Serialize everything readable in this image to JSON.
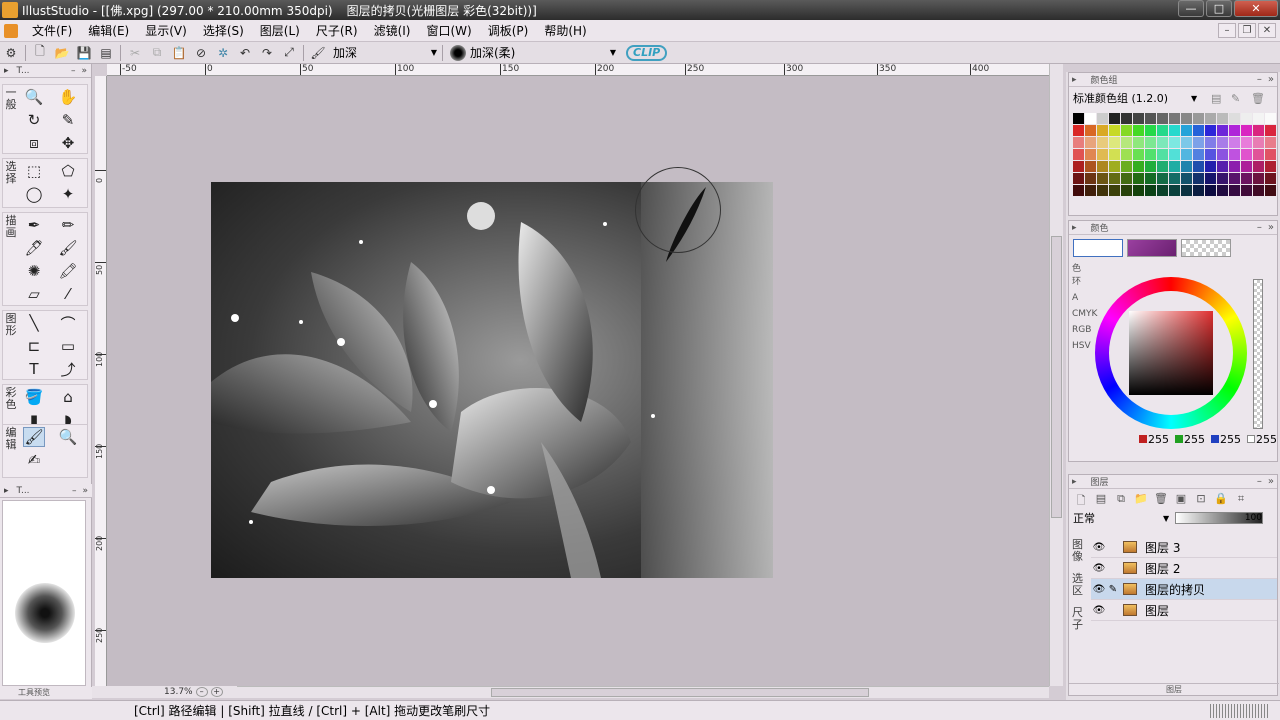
{
  "window": {
    "app_title": "IllustStudio - [[佛.xpg] (297.00 * 210.00mm 350dpi)",
    "doc_info": "图层的拷贝(光栅图层 彩色(32bit))]",
    "min_label": "—",
    "max_label": "□",
    "close_label": "✕"
  },
  "menu": {
    "items": [
      "文件(F)",
      "编辑(E)",
      "显示(V)",
      "选择(S)",
      "图层(L)",
      "尺子(R)",
      "滤镜(I)",
      "窗口(W)",
      "调板(P)",
      "帮助(H)"
    ]
  },
  "toolbar": {
    "blend_mode": "加深",
    "brush_name": "加深(柔)",
    "logo": "CLIP"
  },
  "tool_palette": {
    "title": "T...",
    "groups": [
      {
        "label": "一般"
      },
      {
        "label": "选择"
      },
      {
        "label": "描画"
      },
      {
        "label": "图形"
      },
      {
        "label": "彩色"
      },
      {
        "label": "编辑"
      }
    ],
    "brush_preview_title": "T...",
    "footer": "工具预览"
  },
  "ruler": {
    "top_labels": [
      "-50",
      "0",
      "50",
      "100",
      "150",
      "200",
      "250",
      "300",
      "350",
      "400"
    ],
    "left_labels": [
      "0",
      "50",
      "100",
      "150",
      "200",
      "250"
    ]
  },
  "canvas": {
    "zoom": "13.7%"
  },
  "swatch_panel": {
    "title": "颜色组",
    "set_name": "标准颜色组 (1.2.0)"
  },
  "color_panel": {
    "title": "颜色",
    "side_tabs": [
      "色环",
      "A",
      "CMYK",
      "RGB",
      "HSV"
    ],
    "r": "255",
    "g": "255",
    "b": "255",
    "a": "255"
  },
  "layer_panel": {
    "title": "图层",
    "blend_mode": "正常",
    "opacity": "100",
    "side_tabs": [
      "图像",
      "选区",
      "尺子"
    ],
    "layers": [
      {
        "name": "图层 3"
      },
      {
        "name": "图层 2"
      },
      {
        "name": "图层的拷贝"
      },
      {
        "name": "图层"
      }
    ],
    "footer": "图层"
  },
  "status": {
    "hint": "[Ctrl] 路径编辑 | [Shift] 拉直线 / [Ctrl] + [Alt] 拖动更改笔刷尺寸"
  },
  "colors": {
    "accent_selection": "#c8d8ec",
    "canvas_bg": "#c4bcc4"
  }
}
